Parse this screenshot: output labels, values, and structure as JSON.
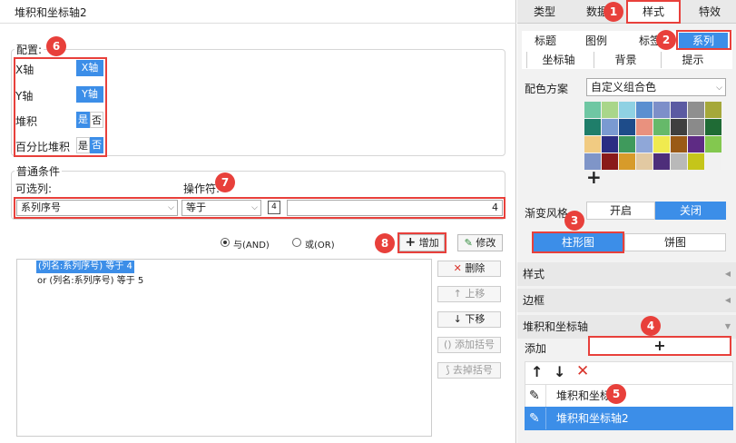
{
  "dialog": {
    "title": "堆积和坐标轴2",
    "config_legend": "配置:",
    "config_rows": [
      {
        "label": "X轴",
        "on": "X轴"
      },
      {
        "label": "Y轴",
        "on": "Y轴"
      },
      {
        "label": "堆积",
        "yes": "是",
        "no": "否"
      },
      {
        "label": "百分比堆积",
        "yes": "是",
        "no": "否"
      }
    ],
    "condition_legend": "普通条件",
    "column_label": "可选列:",
    "operator_label": "操作符:",
    "column_value": "系列序号",
    "operator_value": "等于",
    "param_icon": "4",
    "value_input": "4",
    "and_label": "与(AND)",
    "or_label": "或(OR)",
    "add_label": "增加",
    "modify_label": "修改",
    "conditions": [
      "(列名:系列序号) 等于 4",
      "or  (列名:系列序号) 等于 5"
    ],
    "delete_label": "删除",
    "move_up_label": "上移",
    "move_down_label": "下移",
    "add_paren_label": "添加括号",
    "remove_paren_label": "去掉括号"
  },
  "right": {
    "tabs": [
      "类型",
      "数据",
      "样式",
      "特效"
    ],
    "subtabs_row1": [
      "标题",
      "图例",
      "标签",
      "系列"
    ],
    "subtabs_row2": [
      "坐标轴",
      "背景",
      "提示"
    ],
    "color_scheme_label": "配色方案",
    "color_scheme_value": "自定义组合色",
    "add_color": "+",
    "gradient_label": "渐变风格",
    "gradient_on": "开启",
    "gradient_off": "关闭",
    "shape_bar": "柱形图",
    "shape_pie": "饼图",
    "section_style": "样式",
    "section_border": "边框",
    "section_stack": "堆积和坐标轴",
    "add_label": "添加",
    "add_plus": "+",
    "tree_items": [
      "堆积和坐标轴",
      "堆积和坐标轴2"
    ],
    "swatch_colors": [
      "#6fc7a3",
      "#a9d68a",
      "#8fd1e3",
      "#5b8fd0",
      "#7d8fc9",
      "#5b5aa2",
      "#8f8f8f",
      "#a5a83a",
      "#1f7e6a",
      "#7a9ad1",
      "#1e4c8a",
      "#e9917e",
      "#66b96a",
      "#3f3f3f",
      "#8a8a8a",
      "#1f6b35",
      "#f1cb82",
      "#2b2d83",
      "#3f9a5c",
      "#8fa7d8",
      "#f0ea4f",
      "#9a5a16",
      "#5e2b84",
      "#83c84f",
      "#7f95c8",
      "#8a1a1a",
      "#d79b2a",
      "#e2c9a2",
      "#4e2e7a",
      "#b9b9b9",
      "#c5c51a",
      "#f1f1f1"
    ],
    "accent": "#3c8ee8"
  },
  "annotations": [
    "1",
    "2",
    "3",
    "4",
    "5",
    "6",
    "7",
    "8"
  ]
}
